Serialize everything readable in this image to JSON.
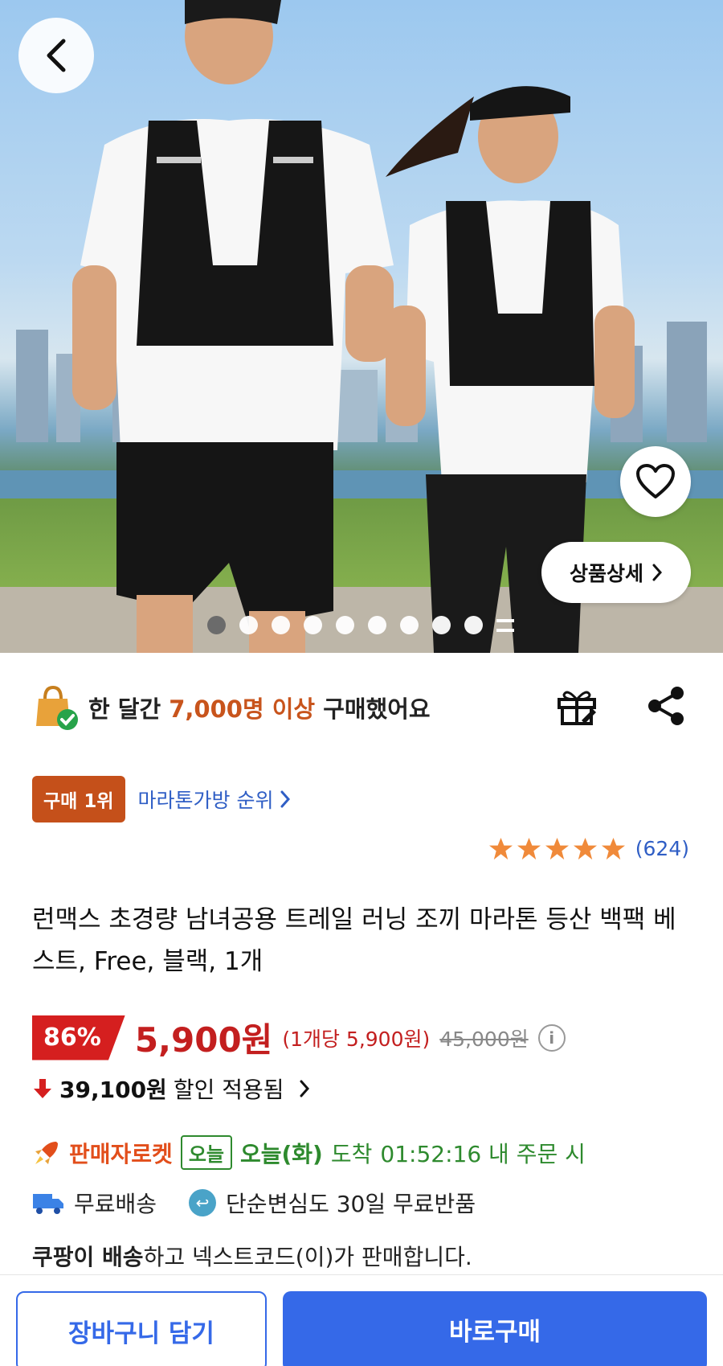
{
  "hero": {
    "slide_count": 9,
    "active_slide": 1,
    "detail_button_label": "상품상세",
    "icons": {
      "back": "back-arrow-icon",
      "wishlist": "heart-icon",
      "detail_chevron": "chevron-right-icon"
    }
  },
  "buyers": {
    "prefix": "한 달간 ",
    "highlight": "7,000명 이상",
    "suffix": " 구매했어요",
    "highlight_color": "#c8541c"
  },
  "rank": {
    "badge_label": "구매 1위",
    "category_link": "마라톤가방 순위"
  },
  "rating": {
    "stars": 5,
    "count_label": "(624)"
  },
  "product": {
    "title": "런맥스 초경량 남녀공용 트레일 러닝 조끼 마라톤 등산 백팩 베스트, Free, 블랙, 1개"
  },
  "price": {
    "discount": "86%",
    "sale_price": "5,900원",
    "unit_price": "(1개당 5,900원)",
    "original_price": "45,000원",
    "info_label": "i",
    "accent_color": "#c31f1f"
  },
  "saving": {
    "amount": "39,100원",
    "label": " 할인 적용됨"
  },
  "delivery": {
    "rocket_label": "판매자로켓",
    "today_badge": "오늘",
    "arrive_day": "오늘(화)",
    "arrive_label": "도착",
    "deadline": "01:52:16 내 주문 시",
    "free_shipping": "무료배송",
    "free_return": "단순변심도 30일 무료반품"
  },
  "seller": {
    "ship_bold": "쿠팡이 배송",
    "rest": "하고 넥스트코드(이)가 판매합니다."
  },
  "bottom_bar": {
    "cart_label": "장바구니 담기",
    "buy_label": "바로구매",
    "brand_color": "#3569e8"
  }
}
